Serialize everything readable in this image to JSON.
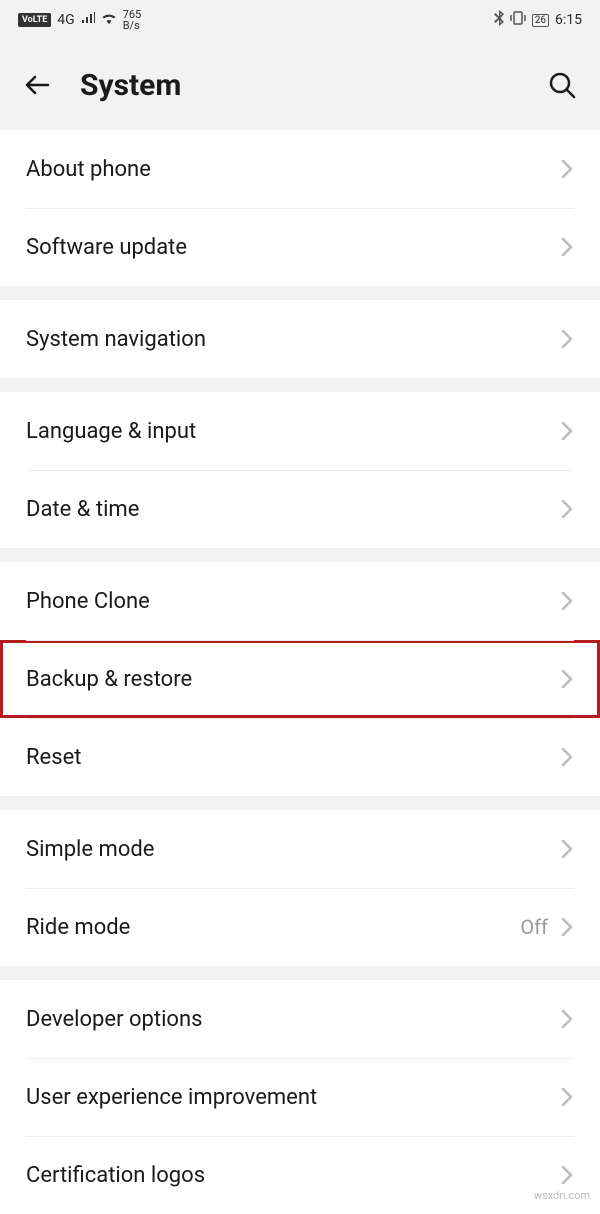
{
  "status": {
    "volte": "VoLTE",
    "net": "4G",
    "speed_top": "765",
    "speed_bottom": "B/s",
    "battery": "26",
    "time": "6:15"
  },
  "header": {
    "title": "System"
  },
  "groups": [
    {
      "rows": [
        {
          "id": "about-phone",
          "label": "About phone"
        },
        {
          "id": "software-update",
          "label": "Software update"
        }
      ]
    },
    {
      "rows": [
        {
          "id": "system-navigation",
          "label": "System navigation"
        }
      ]
    },
    {
      "rows": [
        {
          "id": "language-input",
          "label": "Language & input"
        },
        {
          "id": "date-time",
          "label": "Date & time"
        }
      ]
    },
    {
      "rows": [
        {
          "id": "phone-clone",
          "label": "Phone Clone"
        },
        {
          "id": "backup-restore",
          "label": "Backup & restore",
          "highlight": true
        },
        {
          "id": "reset",
          "label": "Reset"
        }
      ]
    },
    {
      "rows": [
        {
          "id": "simple-mode",
          "label": "Simple mode"
        },
        {
          "id": "ride-mode",
          "label": "Ride mode",
          "value": "Off"
        }
      ]
    },
    {
      "rows": [
        {
          "id": "developer-options",
          "label": "Developer options"
        },
        {
          "id": "user-experience",
          "label": "User experience improvement"
        },
        {
          "id": "certification-logos",
          "label": "Certification logos"
        }
      ]
    }
  ],
  "watermark": "wsxdn.com"
}
